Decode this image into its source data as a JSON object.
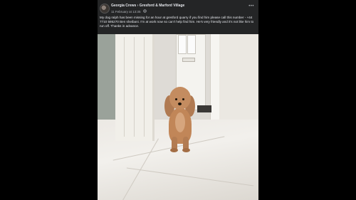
{
  "post": {
    "author": "Georgia Crews",
    "arrow": "›",
    "group": "Gresford & Marford Village",
    "timestamp": "11 February at 13:35",
    "audience_icon": "globe-icon",
    "more_label": "•••",
    "text": "My dog ralph has been missing for an hour at gresford quarry if you find him please call this number - +44 7710 595270 Ben sheibani. I'm at work now so can't help find him. He's very friendly and it's not like him to run off. Thanks in advance."
  },
  "colors": {
    "background": "#000000",
    "post_bg": "#242526",
    "text_primary": "#e4e6eb",
    "text_secondary": "#b0b3b8"
  }
}
